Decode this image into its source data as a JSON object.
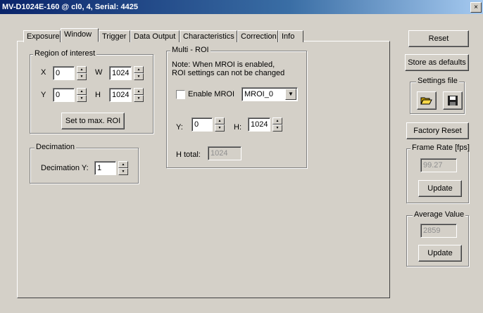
{
  "window": {
    "title": "MV-D1024E-160 @ cl0, 4, Serial: 4425",
    "close_glyph": "×"
  },
  "tabs": [
    {
      "label": "Exposure",
      "active": false
    },
    {
      "label": "Window",
      "active": true
    },
    {
      "label": "Trigger",
      "active": false
    },
    {
      "label": "Data Output",
      "active": false
    },
    {
      "label": "Characteristics",
      "active": false
    },
    {
      "label": "Correction",
      "active": false
    },
    {
      "label": "Info",
      "active": false
    }
  ],
  "roi": {
    "legend": "Region of interest",
    "x_label": "X",
    "x_value": "0",
    "w_label": "W",
    "w_value": "1024",
    "y_label": "Y",
    "y_value": "0",
    "h_label": "H",
    "h_value": "1024",
    "max_button": "Set to max. ROI"
  },
  "mroi": {
    "legend": "Multi - ROI",
    "note_line1": "Note: When MROI is enabled,",
    "note_line2": "ROI settings can not be changed",
    "enable_label": "Enable MROI",
    "enable_checked": false,
    "select_value": "MROI_0",
    "y_label": "Y:",
    "y_value": "0",
    "h_label": "H:",
    "h_value": "1024",
    "htotal_label": "H total:",
    "htotal_value": "1024"
  },
  "decimation": {
    "legend": "Decimation",
    "y_label": "Decimation Y:",
    "y_value": "1"
  },
  "side": {
    "reset": "Reset",
    "store_defaults": "Store as defaults",
    "settings_legend": "Settings file",
    "factory_reset": "Factory Reset",
    "frame_rate_legend": "Frame Rate [fps]",
    "frame_rate_value": "99.27",
    "frame_rate_update": "Update",
    "avg_legend": "Average Value",
    "avg_value": "2859",
    "avg_update": "Update"
  },
  "colors": {
    "titlebar_start": "#0a246a",
    "titlebar_end": "#a6caf0",
    "face": "#d4d0c8"
  },
  "icons": {
    "open": "folder-open-icon",
    "save": "floppy-save-icon"
  }
}
